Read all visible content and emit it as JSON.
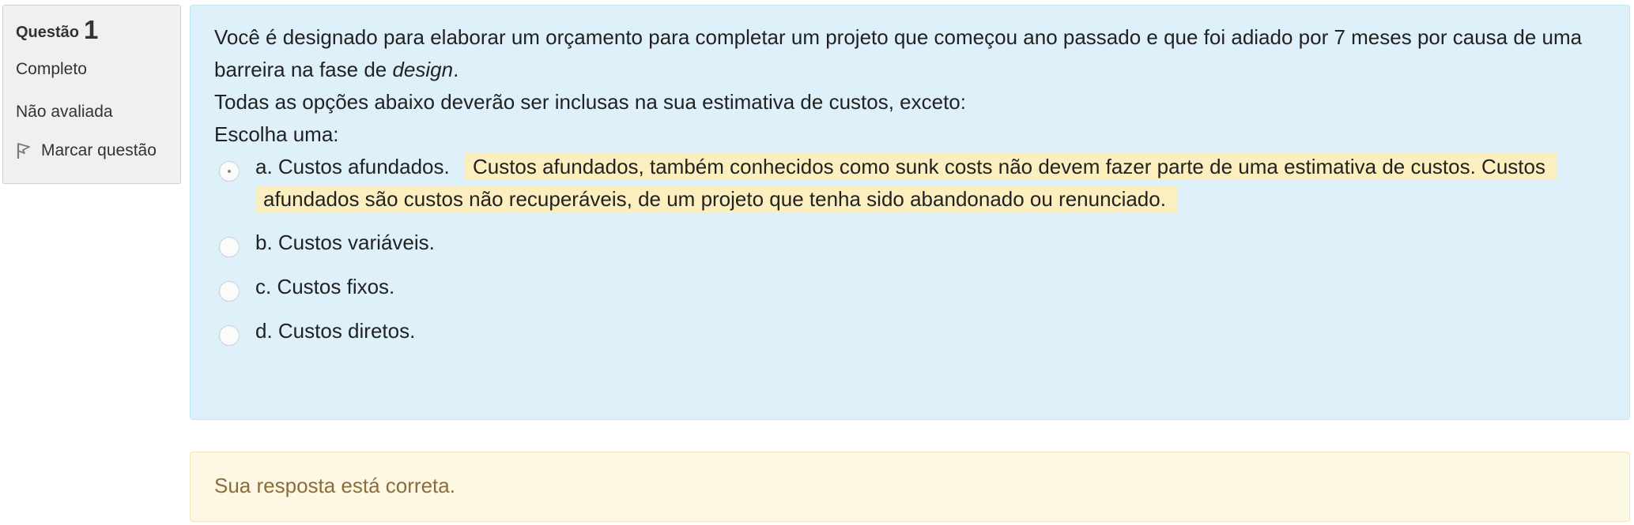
{
  "info": {
    "question_label": "Questão",
    "question_number": "1",
    "state": "Completo",
    "grade": "Não avaliada",
    "flag_label": "Marcar questão"
  },
  "question": {
    "text_part1": "Você é designado para elaborar um orçamento para completar um projeto que começou ano passado e que foi adiado por 7 meses por causa de uma barreira na fase de ",
    "text_emphasis": "design",
    "text_part2": ".",
    "text2": "Todas as opções abaixo deverão ser inclusas na sua estimativa de custos, exceto:",
    "prompt": "Escolha uma:"
  },
  "answers": [
    {
      "label": "a. Custos afundados.",
      "checked": true,
      "feedback": "Custos afundados, também conhecidos como sunk costs não devem fazer parte de uma estimativa de custos. Custos afundados são custos não recuperáveis, de um projeto que tenha sido abandonado ou renunciado."
    },
    {
      "label": "b. Custos variáveis.",
      "checked": false
    },
    {
      "label": "c. Custos fixos.",
      "checked": false
    },
    {
      "label": "d. Custos diretos.",
      "checked": false
    }
  ],
  "outcome": {
    "message": "Sua resposta está correta."
  },
  "colors": {
    "content_bg": "#def0fa",
    "feedback_highlight": "#fcefbf",
    "outcome_bg": "#fcf8e3",
    "outcome_text": "#8a6d3b"
  }
}
